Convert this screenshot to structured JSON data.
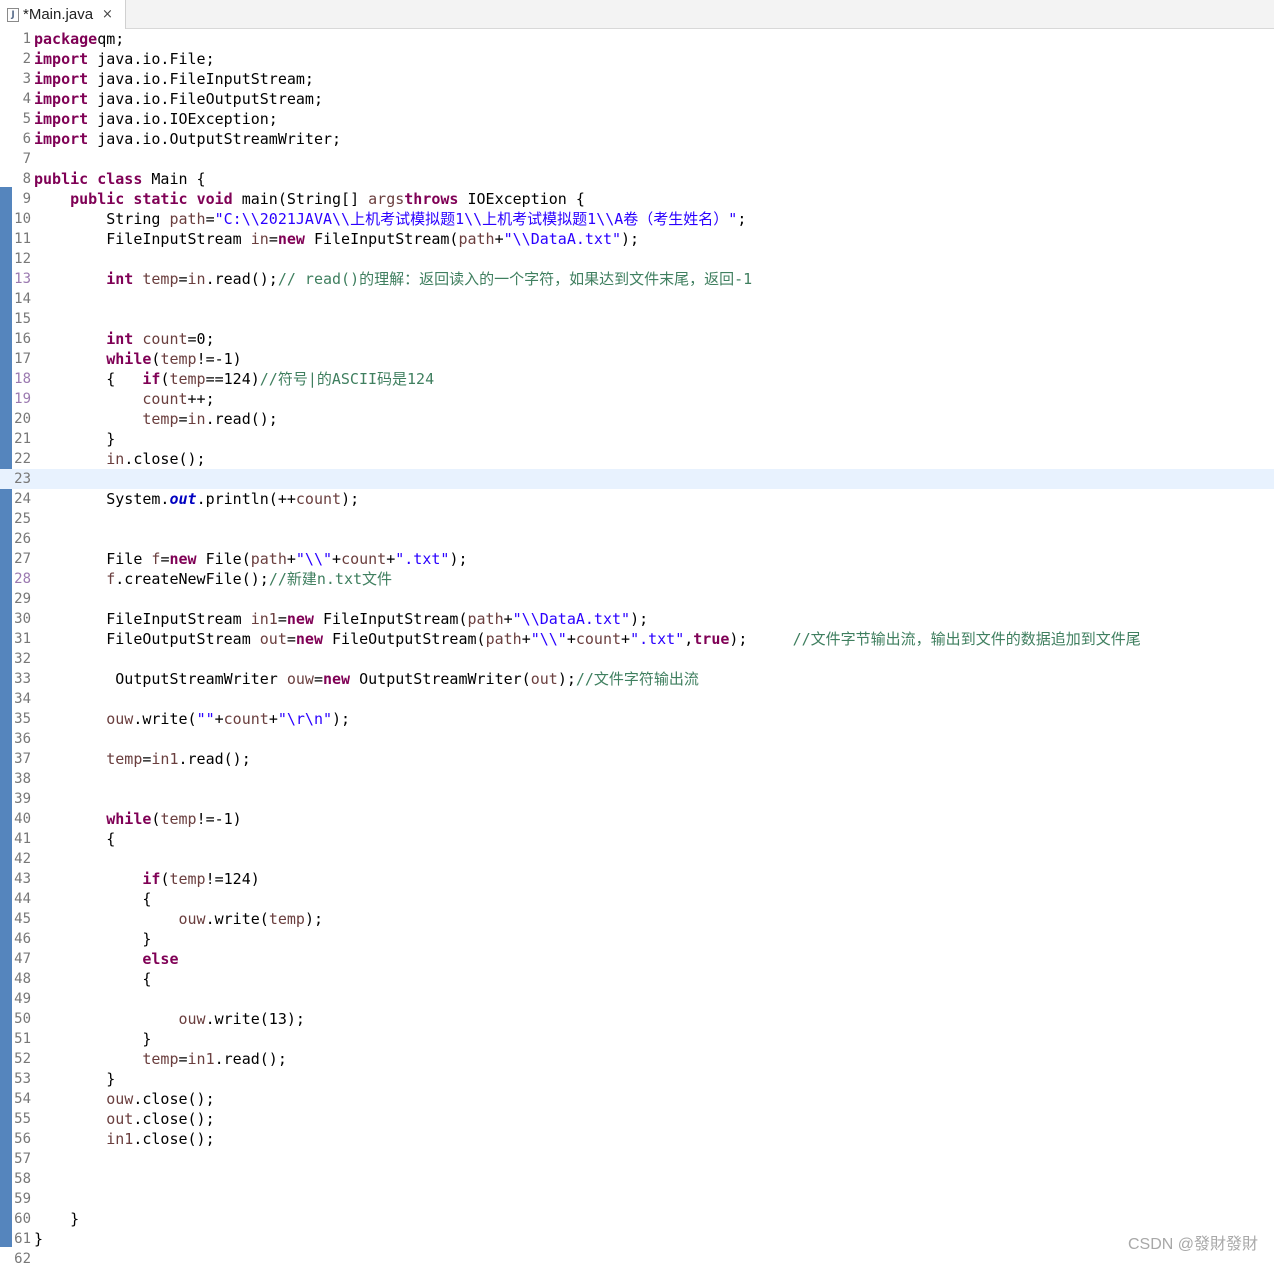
{
  "tab": {
    "title": "*Main.java",
    "close_glyph": "×",
    "icon": "java-file-icon"
  },
  "editor": {
    "current_line": 23,
    "changed_line_numbers": [
      13,
      18,
      19,
      28
    ],
    "lines": [
      {
        "n": 1,
        "tokens": [
          [
            "kw",
            "package"
          ],
          [
            "",
            "qm;"
          ]
        ]
      },
      {
        "n": 2,
        "tokens": [
          [
            "kw",
            "import"
          ],
          [
            "",
            " java.io.File;"
          ]
        ]
      },
      {
        "n": 3,
        "tokens": [
          [
            "kw",
            "import"
          ],
          [
            "",
            " java.io.FileInputStream;"
          ]
        ]
      },
      {
        "n": 4,
        "tokens": [
          [
            "kw",
            "import"
          ],
          [
            "",
            " java.io.FileOutputStream;"
          ]
        ]
      },
      {
        "n": 5,
        "tokens": [
          [
            "kw",
            "import"
          ],
          [
            "",
            " java.io.IOException;"
          ]
        ]
      },
      {
        "n": 6,
        "tokens": [
          [
            "kw",
            "import"
          ],
          [
            "",
            " java.io.OutputStreamWriter;"
          ]
        ]
      },
      {
        "n": 7,
        "tokens": []
      },
      {
        "n": 8,
        "tokens": [
          [
            "kw",
            "public"
          ],
          [
            "",
            " "
          ],
          [
            "kw",
            "class"
          ],
          [
            "",
            " Main {"
          ]
        ]
      },
      {
        "n": 9,
        "tokens": [
          [
            "",
            "    "
          ],
          [
            "kw",
            "public"
          ],
          [
            "",
            " "
          ],
          [
            "kw",
            "static"
          ],
          [
            "",
            " "
          ],
          [
            "kw",
            "void"
          ],
          [
            "",
            " main(String[] "
          ],
          [
            "var",
            "args"
          ],
          [
            ") "
          ],
          [
            "kw",
            "throws"
          ],
          [
            "",
            " IOException {"
          ]
        ]
      },
      {
        "n": 10,
        "tokens": [
          [
            "",
            "        String "
          ],
          [
            "var",
            "path"
          ],
          [
            "",
            "="
          ],
          [
            "str",
            "\"C:\\\\2021JAVA\\\\上机考试模拟题1\\\\上机考试模拟题1\\\\A卷（考生姓名）\""
          ],
          [
            "",
            ";"
          ]
        ]
      },
      {
        "n": 11,
        "tokens": [
          [
            "",
            "        FileInputStream "
          ],
          [
            "var",
            "in"
          ],
          [
            "",
            "="
          ],
          [
            "kw",
            "new"
          ],
          [
            "",
            " FileInputStream("
          ],
          [
            "var",
            "path"
          ],
          [
            "",
            "+"
          ],
          [
            "str",
            "\"\\\\DataA.txt\""
          ],
          [
            "",
            ");"
          ]
        ]
      },
      {
        "n": 12,
        "tokens": []
      },
      {
        "n": 13,
        "tokens": [
          [
            "",
            "        "
          ],
          [
            "kw",
            "int"
          ],
          [
            "",
            " "
          ],
          [
            "var",
            "temp"
          ],
          [
            "",
            "="
          ],
          [
            "var",
            "in"
          ],
          [
            "",
            ".read();"
          ],
          [
            "cmt",
            "// read()的理解：返回读入的一个字符，如果达到文件末尾，返回-1"
          ]
        ]
      },
      {
        "n": 14,
        "tokens": []
      },
      {
        "n": 15,
        "tokens": []
      },
      {
        "n": 16,
        "tokens": [
          [
            "",
            "        "
          ],
          [
            "kw",
            "int"
          ],
          [
            "",
            " "
          ],
          [
            "var",
            "count"
          ],
          [
            "",
            "=0;"
          ]
        ]
      },
      {
        "n": 17,
        "tokens": [
          [
            "",
            "        "
          ],
          [
            "kw",
            "while"
          ],
          [
            "",
            "("
          ],
          [
            "var",
            "temp"
          ],
          [
            "",
            "!=-1)"
          ]
        ]
      },
      {
        "n": 18,
        "tokens": [
          [
            "",
            "        {   "
          ],
          [
            "kw",
            "if"
          ],
          [
            "",
            "("
          ],
          [
            "var",
            "temp"
          ],
          [
            "",
            "==124)"
          ],
          [
            "cmt",
            "//符号|的ASCII码是124"
          ]
        ]
      },
      {
        "n": 19,
        "tokens": [
          [
            "",
            "            "
          ],
          [
            "var",
            "count"
          ],
          [
            "",
            "++;"
          ]
        ]
      },
      {
        "n": 20,
        "tokens": [
          [
            "",
            "            "
          ],
          [
            "var",
            "temp"
          ],
          [
            "",
            "="
          ],
          [
            "var",
            "in"
          ],
          [
            "",
            ".read();"
          ]
        ]
      },
      {
        "n": 21,
        "tokens": [
          [
            "",
            "        }"
          ]
        ]
      },
      {
        "n": 22,
        "tokens": [
          [
            "",
            "        "
          ],
          [
            "var",
            "in"
          ],
          [
            "",
            ".close();"
          ]
        ]
      },
      {
        "n": 23,
        "tokens": []
      },
      {
        "n": 24,
        "tokens": [
          [
            "",
            "        System."
          ],
          [
            "fld",
            "out"
          ],
          [
            "",
            ".println(++"
          ],
          [
            "var",
            "count"
          ],
          [
            "",
            ");"
          ]
        ]
      },
      {
        "n": 25,
        "tokens": []
      },
      {
        "n": 26,
        "tokens": []
      },
      {
        "n": 27,
        "tokens": [
          [
            "",
            "        File "
          ],
          [
            "var",
            "f"
          ],
          [
            "",
            "="
          ],
          [
            "kw",
            "new"
          ],
          [
            "",
            " File("
          ],
          [
            "var",
            "path"
          ],
          [
            "",
            "+"
          ],
          [
            "str",
            "\"\\\\\""
          ],
          [
            "",
            "+"
          ],
          [
            "var",
            "count"
          ],
          [
            "",
            "+"
          ],
          [
            "str",
            "\".txt\""
          ],
          [
            "",
            ");"
          ]
        ]
      },
      {
        "n": 28,
        "tokens": [
          [
            "",
            "        "
          ],
          [
            "var",
            "f"
          ],
          [
            "",
            ".createNewFile();"
          ],
          [
            "cmt",
            "//新建n.txt文件"
          ]
        ]
      },
      {
        "n": 29,
        "tokens": []
      },
      {
        "n": 30,
        "tokens": [
          [
            "",
            "        FileInputStream "
          ],
          [
            "var",
            "in1"
          ],
          [
            "",
            "="
          ],
          [
            "kw",
            "new"
          ],
          [
            "",
            " FileInputStream("
          ],
          [
            "var",
            "path"
          ],
          [
            "",
            "+"
          ],
          [
            "str",
            "\"\\\\DataA.txt\""
          ],
          [
            "",
            ");"
          ]
        ]
      },
      {
        "n": 31,
        "tokens": [
          [
            "",
            "        FileOutputStream "
          ],
          [
            "var",
            "out"
          ],
          [
            "",
            "="
          ],
          [
            "kw",
            "new"
          ],
          [
            "",
            " FileOutputStream("
          ],
          [
            "var",
            "path"
          ],
          [
            "",
            "+"
          ],
          [
            "str",
            "\"\\\\\""
          ],
          [
            "",
            "+"
          ],
          [
            "var",
            "count"
          ],
          [
            "",
            "+"
          ],
          [
            "str",
            "\".txt\""
          ],
          [
            "",
            ","
          ],
          [
            "kw",
            "true"
          ],
          [
            "",
            ");     "
          ],
          [
            "cmt",
            "//文件字节输出流，输出到文件的数据追加到文件尾"
          ]
        ]
      },
      {
        "n": 32,
        "tokens": []
      },
      {
        "n": 33,
        "tokens": [
          [
            "",
            "         OutputStreamWriter "
          ],
          [
            "var",
            "ouw"
          ],
          [
            "",
            "="
          ],
          [
            "kw",
            "new"
          ],
          [
            "",
            " OutputStreamWriter("
          ],
          [
            "var",
            "out"
          ],
          [
            "",
            ");"
          ],
          [
            "cmt",
            "//文件字符输出流"
          ]
        ]
      },
      {
        "n": 34,
        "tokens": []
      },
      {
        "n": 35,
        "tokens": [
          [
            "",
            "        "
          ],
          [
            "var",
            "ouw"
          ],
          [
            "",
            ".write("
          ],
          [
            "str",
            "\"\""
          ],
          [
            "",
            "+"
          ],
          [
            "var",
            "count"
          ],
          [
            "",
            "+"
          ],
          [
            "str",
            "\"\\r\\n\""
          ],
          [
            "",
            ");"
          ]
        ]
      },
      {
        "n": 36,
        "tokens": []
      },
      {
        "n": 37,
        "tokens": [
          [
            "",
            "        "
          ],
          [
            "var",
            "temp"
          ],
          [
            "",
            "="
          ],
          [
            "var",
            "in1"
          ],
          [
            "",
            ".read();"
          ]
        ]
      },
      {
        "n": 38,
        "tokens": []
      },
      {
        "n": 39,
        "tokens": []
      },
      {
        "n": 40,
        "tokens": [
          [
            "",
            "        "
          ],
          [
            "kw",
            "while"
          ],
          [
            "",
            "("
          ],
          [
            "var",
            "temp"
          ],
          [
            "",
            "!=-1)"
          ]
        ]
      },
      {
        "n": 41,
        "tokens": [
          [
            "",
            "        {"
          ]
        ]
      },
      {
        "n": 42,
        "tokens": []
      },
      {
        "n": 43,
        "tokens": [
          [
            "",
            "            "
          ],
          [
            "kw",
            "if"
          ],
          [
            "",
            "("
          ],
          [
            "var",
            "temp"
          ],
          [
            "",
            "!=124)"
          ]
        ]
      },
      {
        "n": 44,
        "tokens": [
          [
            "",
            "            {"
          ]
        ]
      },
      {
        "n": 45,
        "tokens": [
          [
            "",
            "                "
          ],
          [
            "var",
            "ouw"
          ],
          [
            "",
            ".write("
          ],
          [
            "var",
            "temp"
          ],
          [
            "",
            ");"
          ]
        ]
      },
      {
        "n": 46,
        "tokens": [
          [
            "",
            "            }"
          ]
        ]
      },
      {
        "n": 47,
        "tokens": [
          [
            "",
            "            "
          ],
          [
            "kw",
            "else"
          ]
        ]
      },
      {
        "n": 48,
        "tokens": [
          [
            "",
            "            {"
          ]
        ]
      },
      {
        "n": 49,
        "tokens": []
      },
      {
        "n": 50,
        "tokens": [
          [
            "",
            "                "
          ],
          [
            "var",
            "ouw"
          ],
          [
            "",
            ".write(13);"
          ]
        ]
      },
      {
        "n": 51,
        "tokens": [
          [
            "",
            "            }"
          ]
        ]
      },
      {
        "n": 52,
        "tokens": [
          [
            "",
            "            "
          ],
          [
            "var",
            "temp"
          ],
          [
            "",
            "="
          ],
          [
            "var",
            "in1"
          ],
          [
            "",
            ".read();"
          ]
        ]
      },
      {
        "n": 53,
        "tokens": [
          [
            "",
            "        }"
          ]
        ]
      },
      {
        "n": 54,
        "tokens": [
          [
            "",
            "        "
          ],
          [
            "var",
            "ouw"
          ],
          [
            "",
            ".close();"
          ]
        ]
      },
      {
        "n": 55,
        "tokens": [
          [
            "",
            "        "
          ],
          [
            "var",
            "out"
          ],
          [
            "",
            ".close();"
          ]
        ]
      },
      {
        "n": 56,
        "tokens": [
          [
            "",
            "        "
          ],
          [
            "var",
            "in1"
          ],
          [
            "",
            ".close();"
          ]
        ]
      },
      {
        "n": 57,
        "tokens": []
      },
      {
        "n": 58,
        "tokens": []
      },
      {
        "n": 59,
        "tokens": []
      },
      {
        "n": 60,
        "tokens": [
          [
            "",
            "    }"
          ]
        ]
      },
      {
        "n": 61,
        "tokens": [
          [
            "",
            "}"
          ]
        ]
      },
      {
        "n": 62,
        "tokens": []
      }
    ]
  },
  "watermark": "CSDN @發財發財"
}
